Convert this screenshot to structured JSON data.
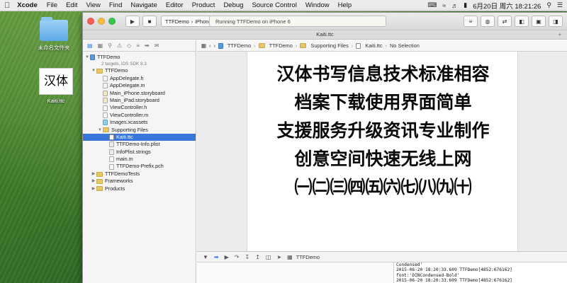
{
  "menubar": {
    "apple_icon": "apple-icon",
    "app_name": "Xcode",
    "items": [
      "File",
      "Edit",
      "View",
      "Find",
      "Navigate",
      "Editor",
      "Product",
      "Debug",
      "Source Control",
      "Window",
      "Help"
    ],
    "status_icons": [
      "input-method-icon",
      "wifi-icon",
      "volume-icon",
      "battery-icon"
    ],
    "clock": "6月20日 周六  18:21:26",
    "search_icon": "spotlight-icon",
    "list_icon": "notification-icon"
  },
  "desktop": {
    "icons": [
      {
        "label": "未命名文件夹",
        "kind": "folder"
      },
      {
        "label": "Kaiti.ttc",
        "kind": "font",
        "preview": "汉体"
      }
    ]
  },
  "toolbar": {
    "run_icon": "▶",
    "stop_icon": "■",
    "scheme_target": "TTFDemo",
    "scheme_device": "iPhone 6",
    "activity": "Running TTFDemo on iPhone 6"
  },
  "window": {
    "title": "Kaiti.ttc"
  },
  "navigator": {
    "project": "TTFDemo",
    "project_sub": "2 targets, iOS SDK 8.3",
    "items": [
      {
        "label": "TTFDemo",
        "indent": 1,
        "kind": "folder",
        "disc": "▼"
      },
      {
        "label": "AppDelegate.h",
        "indent": 2,
        "kind": "h"
      },
      {
        "label": "AppDelegate.m",
        "indent": 2,
        "kind": "m"
      },
      {
        "label": "Main_iPhone.storyboard",
        "indent": 2,
        "kind": "story"
      },
      {
        "label": "Main_iPad.storyboard",
        "indent": 2,
        "kind": "story"
      },
      {
        "label": "ViewController.h",
        "indent": 2,
        "kind": "h"
      },
      {
        "label": "ViewController.m",
        "indent": 2,
        "kind": "m"
      },
      {
        "label": "Images.xcassets",
        "indent": 2,
        "kind": "assets"
      },
      {
        "label": "Supporting Files",
        "indent": 2,
        "kind": "folder",
        "disc": "▼"
      },
      {
        "label": "Kaiti.ttc",
        "indent": 3,
        "kind": "ttc",
        "selected": true
      },
      {
        "label": "TTFDemo-Info.plist",
        "indent": 3,
        "kind": "plist"
      },
      {
        "label": "InfoPlist.strings",
        "indent": 3,
        "kind": "plist"
      },
      {
        "label": "main.m",
        "indent": 3,
        "kind": "m"
      },
      {
        "label": "TTFDemo-Prefix.pch",
        "indent": 3,
        "kind": "h"
      },
      {
        "label": "TTFDemoTests",
        "indent": 1,
        "kind": "folder",
        "disc": "▶"
      },
      {
        "label": "Frameworks",
        "indent": 1,
        "kind": "folder",
        "disc": "▶"
      },
      {
        "label": "Products",
        "indent": 1,
        "kind": "folder",
        "disc": "▶"
      }
    ]
  },
  "jumpbar": {
    "crumbs": [
      "TTFDemo",
      "TTFDemo",
      "Supporting Files",
      "Kaiti.ttc",
      "No Selection"
    ]
  },
  "font_preview": {
    "lines": [
      "汉体书写信息技术标准相容",
      "档案下载使用界面简单",
      "支援服务升级资讯专业制作",
      "创意空间快速无线上网",
      "㈠㈡㈢㈣㈤㈥㈦㈧㈨㈩"
    ]
  },
  "debug": {
    "target_label": "TTFDemo"
  },
  "console": {
    "lines": [
      "Condensed'",
      "2015-06-20 18:20:33.609 TTFDemo[4852:676162]",
      "font:'DINCondensed-Bold'",
      "2015-06-20 18:20:33.609 TTFDemo[4852:676162]",
      "============"
    ]
  }
}
